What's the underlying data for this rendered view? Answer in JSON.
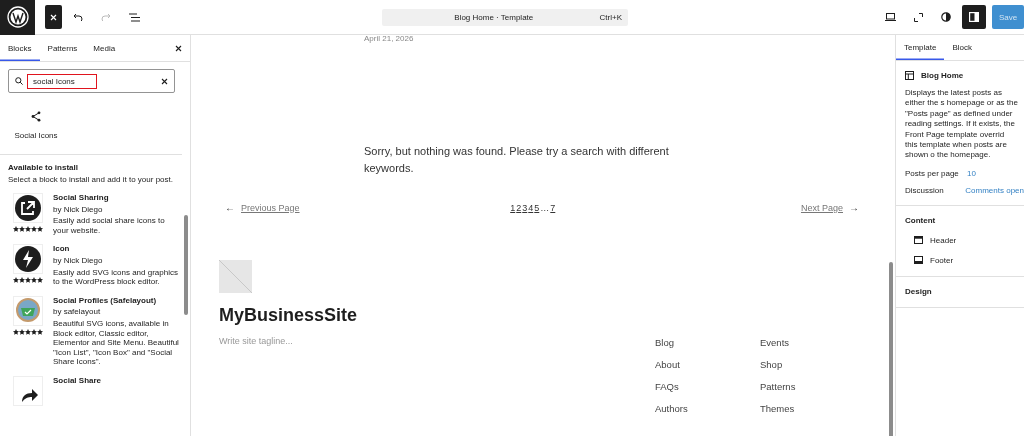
{
  "top_bar": {
    "command": {
      "title": "Blog Home · Template",
      "shortcut": "Ctrl+K"
    },
    "undo_disabled": false,
    "redo_disabled": true,
    "sidebar_open": true,
    "save": {
      "label": "Save",
      "disabled": true
    }
  },
  "inserter": {
    "tabs": [
      {
        "label": "Blocks",
        "selected": true
      },
      {
        "label": "Patterns",
        "selected": false
      },
      {
        "label": "Media",
        "selected": false
      }
    ],
    "search": {
      "value": "social Icons",
      "highlighted": true
    },
    "results": [
      {
        "label": "Social Icons"
      }
    ],
    "install": {
      "heading": "Available to install",
      "description": "Select a block to install and add it to your post.",
      "plugins": [
        {
          "kind": "share",
          "title": "Social Sharing",
          "author": "by Nick Diego",
          "description": "Easily add social share icons to your website.",
          "stars": 5
        },
        {
          "kind": "bolt",
          "title": "Icon",
          "author": "by Nick Diego",
          "description": "Easily add SVG icons and graphics to the WordPress block editor.",
          "stars": 5
        },
        {
          "kind": "basket",
          "title": "Social Profiles (Safelayout)",
          "author": "by safelayout",
          "description": "Beautiful SVG icons, available in Block editor, Classic editor, Elementor and Site Menu. Beautiful \"Icon List\", \"Icon Box\" and \"Social Share Icons\".",
          "stars": 5
        },
        {
          "kind": "forward",
          "title": "Social Share"
        }
      ]
    }
  },
  "canvas": {
    "date": "April 21, 2026",
    "message": "Sorry, but nothing was found. Please try a search with different keywords.",
    "pagination": {
      "previous_arrow": "←",
      "next_arrow": "→",
      "previous": "Previous Page",
      "pages": [
        "1",
        "2",
        "3",
        "4",
        "5",
        "…",
        "7"
      ],
      "next": "Next Page"
    },
    "footer": {
      "site_title": "MyBusinessSite",
      "tagline": "Write site tagline...",
      "nav_columns": [
        [
          "Blog",
          "About",
          "FAQs",
          "Authors"
        ],
        [
          "Events",
          "Shop",
          "Patterns",
          "Themes"
        ]
      ]
    }
  },
  "settings": {
    "tabs": [
      {
        "label": "Template",
        "selected": true
      },
      {
        "label": "Block",
        "selected": false
      }
    ],
    "template": {
      "title": "Blog Home",
      "description": "Displays the latest posts as either the s homepage or as the \"Posts page\" as defined under reading settings. If it exists, the Front Page template overrid this template when posts are shown o the homepage."
    },
    "fields": [
      {
        "label": "Posts per page",
        "value": "10"
      },
      {
        "label": "Discussion",
        "value": "Comments open"
      }
    ],
    "content": {
      "heading": "Content",
      "items": [
        {
          "kind": "header",
          "label": "Header"
        },
        {
          "kind": "footer",
          "label": "Footer"
        }
      ]
    },
    "design": {
      "heading": "Design"
    }
  }
}
